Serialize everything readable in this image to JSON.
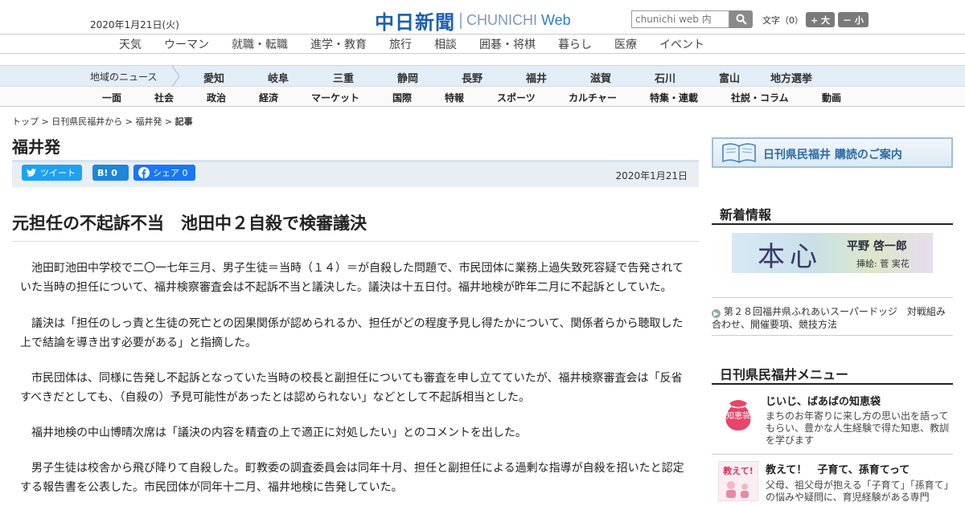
{
  "header": {
    "date": "2020年1月21日(火)",
    "logo_jp": "中日新聞",
    "logo_en_a": "CHUNICHI ",
    "logo_en_b": "Web",
    "search_placeholder": "chunichi web 内",
    "font_size_label": "文字（0）",
    "font_up": "+ 大",
    "font_down": "－ 小"
  },
  "nav_main": [
    "天気",
    "ウーマン",
    "就職・転職",
    "進学・教育",
    "旅行",
    "相談",
    "囲碁・将棋",
    "暮らし",
    "医療",
    "イベント"
  ],
  "nav_region": {
    "label": "地域のニュース",
    "items": [
      "愛知",
      "岐阜",
      "三重",
      "静岡",
      "長野",
      "福井",
      "滋賀",
      "石川",
      "富山",
      "地方選挙"
    ]
  },
  "nav_category": [
    "一面",
    "社会",
    "政治",
    "経済",
    "マーケット",
    "国際",
    "特報",
    "スポーツ",
    "カルチャー",
    "特集・連載",
    "社説・コラム",
    "動画"
  ],
  "breadcrumb": {
    "items": [
      "トップ",
      "日刊県民福井から",
      "福井発"
    ],
    "current": "記事",
    "sep": " > "
  },
  "section_title": "福井発",
  "share": {
    "tweet": "ツイート",
    "hatena": "B! 0",
    "facebook": "シェア 0",
    "date": "2020年1月21日"
  },
  "article": {
    "headline": "元担任の不起訴不当　池田中２自殺で検審議決",
    "paragraphs": [
      "池田町池田中学校で二〇一七年三月、男子生徒＝当時（１４）＝が自殺した問題で、市民団体に業務上過失致死容疑で告発されていた当時の担任について、福井検察審査会は不起訴不当と議決した。議決は十五日付。福井地検が昨年二月に不起訴としていた。",
      "議決は「担任のしっ責と生徒の死亡との因果関係が認められるか、担任がどの程度予見し得たかについて、関係者らから聴取した上で結論を導き出す必要がある」と指摘した。",
      "市民団体は、同様に告発し不起訴となっていた当時の校長と副担任についても審査を申し立てていたが、福井検察審査会は「反省すべきだとしても、（自殺の）予見可能性があったとは認められない」などとして不起訴相当とした。",
      "福井地検の中山博晴次席は「議決の内容を精査の上で適正に対処したい」とのコメントを出した。",
      "男子生徒は校舎から飛び降りて自殺した。町教委の調査委員会は同年十月、担任と副担任による過剰な指導が自殺を招いたと認定する報告書を公表した。市民団体が同年十二月、福井地検に告発していた。"
    ]
  },
  "sidebar": {
    "banner_text": "日刊県民福井 購読のご案内",
    "news_heading": "新着情報",
    "serial": {
      "title": "本心",
      "author": "平野 啓一郎",
      "illustrator": "挿絵: 菅 実花"
    },
    "news_item": "第２８回福井県ふれあいスーパードッジ　対戦組み合わせ、開催要項、競技方法",
    "menu_heading": "日刊県民福井メニュー",
    "menu": [
      {
        "title": "じいじ、ばあばの知恵袋",
        "desc": "まちのお年寄りに来し方の思い出を語ってもらい、豊かな人生経験で得た知恵、教訓を学びます",
        "icon_text": "知恵袋",
        "icon": "wisdom-bag-icon"
      },
      {
        "title": "教えて！　子育て、孫育てって",
        "desc": "父母、祖父母が抱える「子育て」「孫育て」の悩みや疑問に、育児経験がある専門",
        "icon_text": "教えて!",
        "icon": "parenting-icon"
      }
    ]
  },
  "colors": {
    "brand": "#1b5fb2",
    "region_bg": "#e2edf7",
    "twitter": "#1da1f2",
    "hatena": "#1e86d9",
    "facebook": "#1877f2"
  }
}
